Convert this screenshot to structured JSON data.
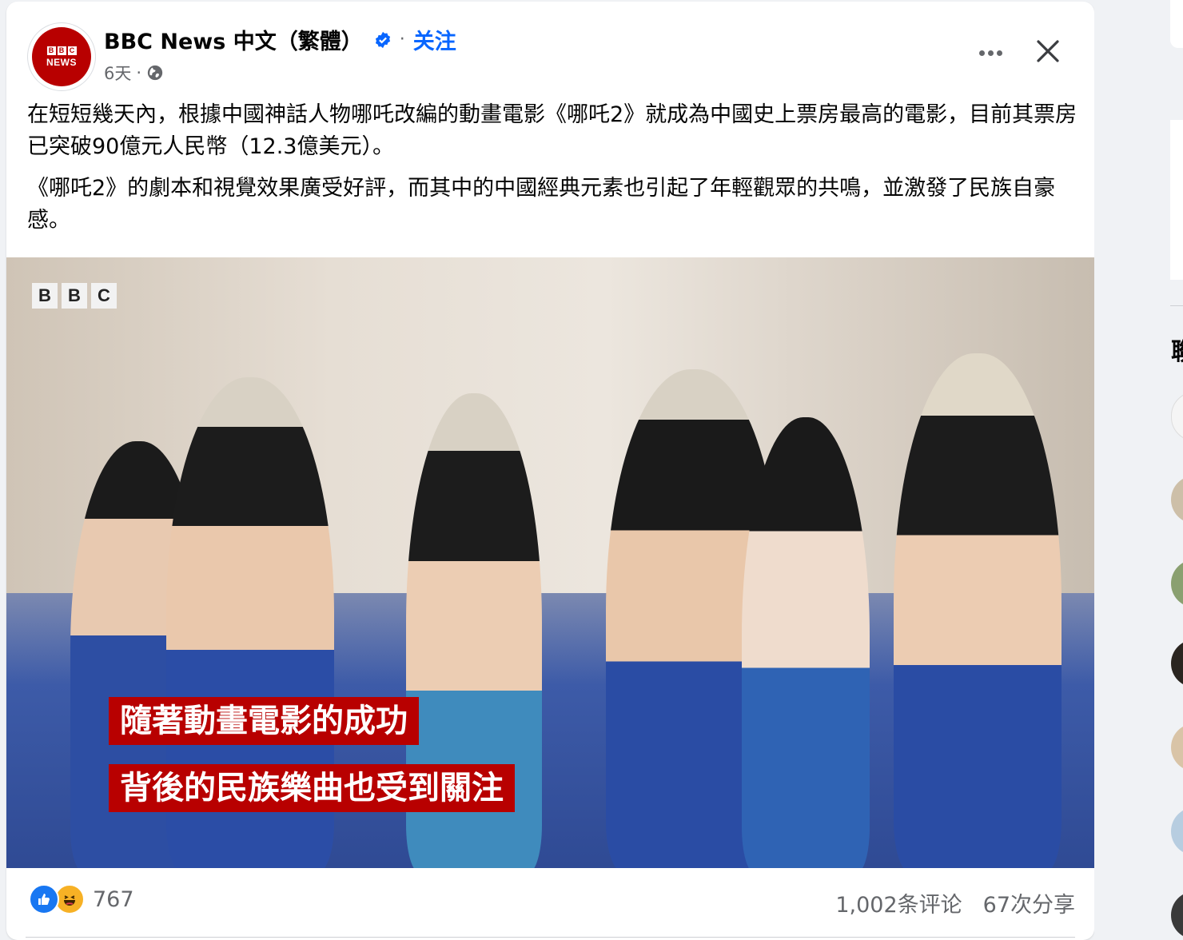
{
  "post": {
    "page_name": "BBC News 中文（繁體）",
    "separator": "·",
    "follow_label": "关注",
    "time": "6天",
    "meta_separator": "·",
    "paragraphs": [
      "在短短幾天內，根據中國神話人物哪吒改編的動畫電影《哪吒2》就成為中國史上票房最高的電影，目前其票房已突破90億元人民幣（12.3億美元）。",
      "《哪吒2》的劇本和視覺效果廣受好評，而其中的中國經典元素也引起了年輕觀眾的共鳴，並激發了民族自豪感。"
    ]
  },
  "avatar": {
    "logo_letters": [
      "B",
      "B",
      "C"
    ],
    "logo_word": "NEWS"
  },
  "video": {
    "watermark_letters": [
      "B",
      "B",
      "C"
    ],
    "caption_line_1": "隨著動畫電影的成功",
    "caption_line_2": "背後的民族樂曲也受到關注"
  },
  "footer": {
    "reaction_count": "767",
    "comments": "1,002条评论",
    "shares": "67次分享"
  },
  "sidebar": {
    "label_fragment": "聯"
  },
  "colors": {
    "accent": "#0866ff",
    "bbc_red": "#b80000",
    "secondary_text": "#65676b"
  },
  "icons": [
    "verified-badge-icon",
    "globe-icon",
    "more-icon",
    "close-icon",
    "like-reaction-icon",
    "haha-reaction-icon"
  ]
}
